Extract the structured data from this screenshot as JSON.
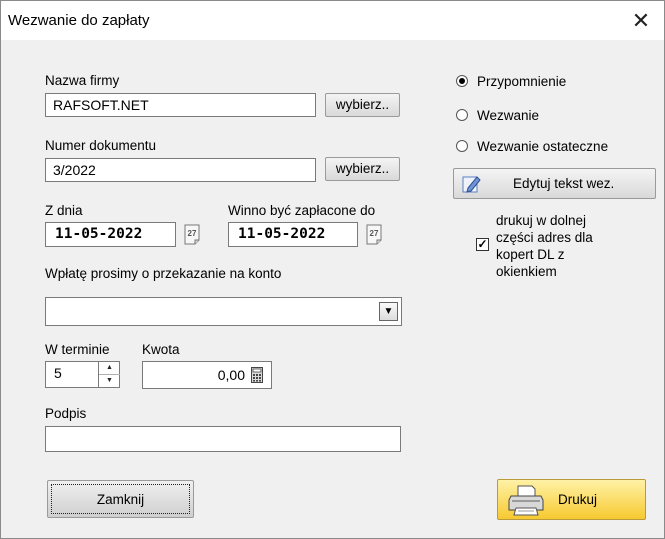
{
  "window": {
    "title": "Wezwanie do zapłaty",
    "close_label": "✕"
  },
  "company": {
    "label": "Nazwa firmy",
    "value": "RAFSOFT.NET",
    "choose_label": "wybierz.."
  },
  "document": {
    "label": "Numer dokumentu",
    "value": "3/2022",
    "choose_label": "wybierz.."
  },
  "from_date": {
    "label": "Z dnia",
    "value": "11-05-2022",
    "calendar_day": "27"
  },
  "due_date": {
    "label": "Winno być zapłacone do",
    "value": "11-05-2022",
    "calendar_day": "27"
  },
  "account": {
    "label": "Wpłatę prosimy o przekazanie na konto",
    "value": ""
  },
  "term": {
    "label": "W terminie",
    "value": "5"
  },
  "amount": {
    "label": "Kwota",
    "value": "0,00"
  },
  "signature": {
    "label": "Podpis",
    "value": ""
  },
  "type_options": [
    {
      "label": "Przypomnienie",
      "selected": true
    },
    {
      "label": "Wezwanie",
      "selected": false
    },
    {
      "label": "Wezwanie ostateczne",
      "selected": false
    }
  ],
  "edit_text_button": "Edytuj tekst wez.",
  "print_address": {
    "checked": true,
    "lines": [
      "drukuj w dolnej",
      "części adres dla",
      "kopert DL z",
      "okienkiem"
    ]
  },
  "close_button": "Zamknij",
  "print_button": "Drukuj",
  "icons": {
    "calendar": "calendar-icon",
    "calculator": "calculator-icon",
    "pencil": "pencil-icon",
    "printer": "printer-icon",
    "dropdown": "chevron-down-icon"
  }
}
